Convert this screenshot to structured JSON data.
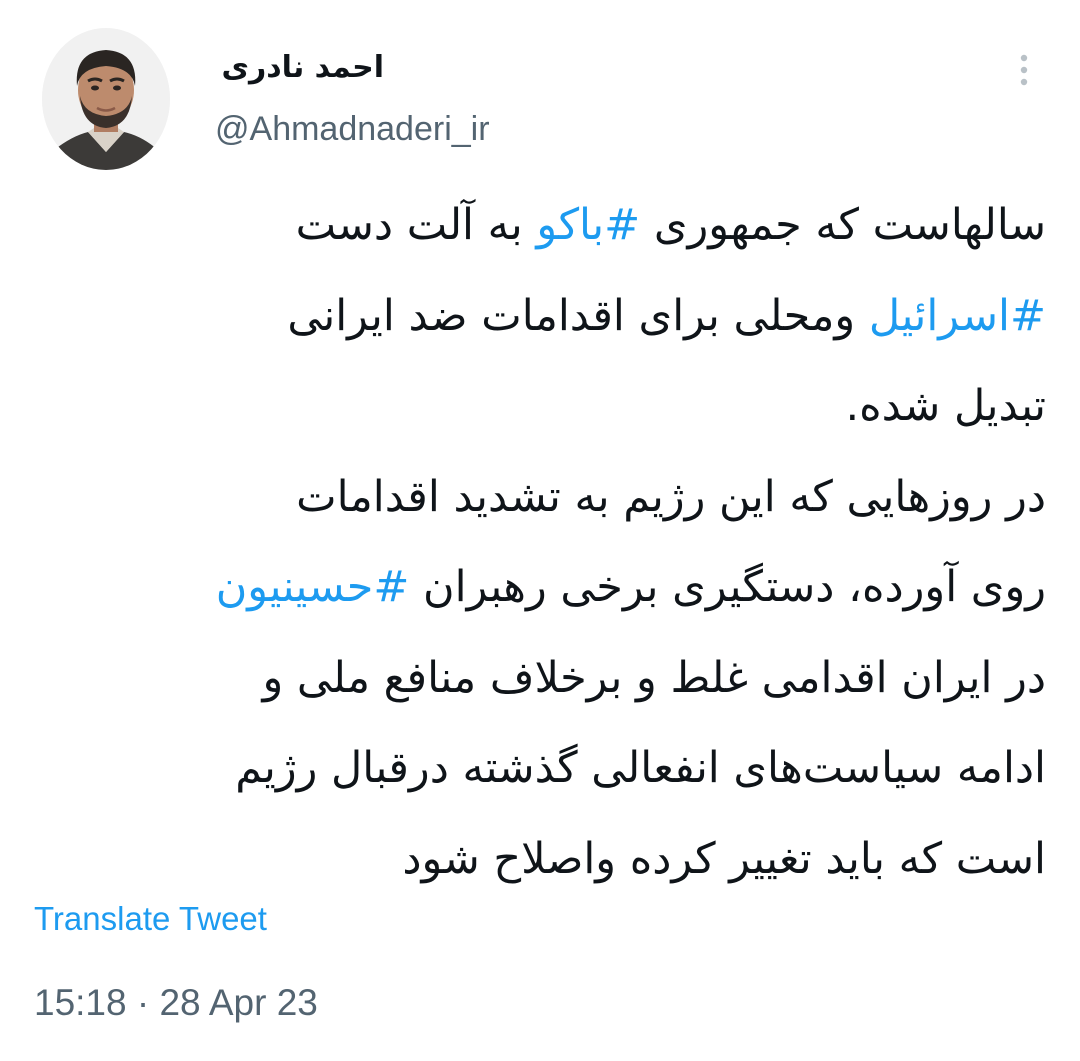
{
  "author": {
    "display_name": "احمد نادری",
    "handle": "@Ahmadnaderi_ir"
  },
  "icons": {
    "more": "more-vertical-icon"
  },
  "tweet": {
    "lines": [
      [
        {
          "text": "سالهاست که جمهوری ",
          "type": "text"
        },
        {
          "text": "#باکو",
          "type": "hashtag"
        },
        {
          "text": " به آلت دست",
          "type": "text"
        }
      ],
      [
        {
          "text": "#اسرائیل",
          "type": "hashtag"
        },
        {
          "text": " ومحلی برای اقدامات ضد ایرانی",
          "type": "text"
        }
      ],
      [
        {
          "text": "تبدیل شده.",
          "type": "text"
        }
      ],
      [
        {
          "text": "در روزهایی که این رژیم به تشدید اقدامات",
          "type": "text"
        }
      ],
      [
        {
          "text": "روی آورده، دستگیری برخی رهبران ",
          "type": "text"
        },
        {
          "text": "#حسینیون",
          "type": "hashtag"
        }
      ],
      [
        {
          "text": "در ایران اقدامی غلط و برخلاف منافع ملی و",
          "type": "text"
        }
      ],
      [
        {
          "text": "ادامه سیاست‌های انفعالی گذشته درقبال رژیم",
          "type": "text"
        }
      ],
      [
        {
          "text": "است که باید تغییر کرده واصلاح شود",
          "type": "text"
        }
      ]
    ]
  },
  "actions": {
    "translate_label": "Translate Tweet"
  },
  "meta": {
    "timestamp": "15:18 · 28 Apr 23"
  },
  "colors": {
    "link": "#1d9bf0",
    "secondary_text": "#536471",
    "primary_text": "#0f1419"
  }
}
